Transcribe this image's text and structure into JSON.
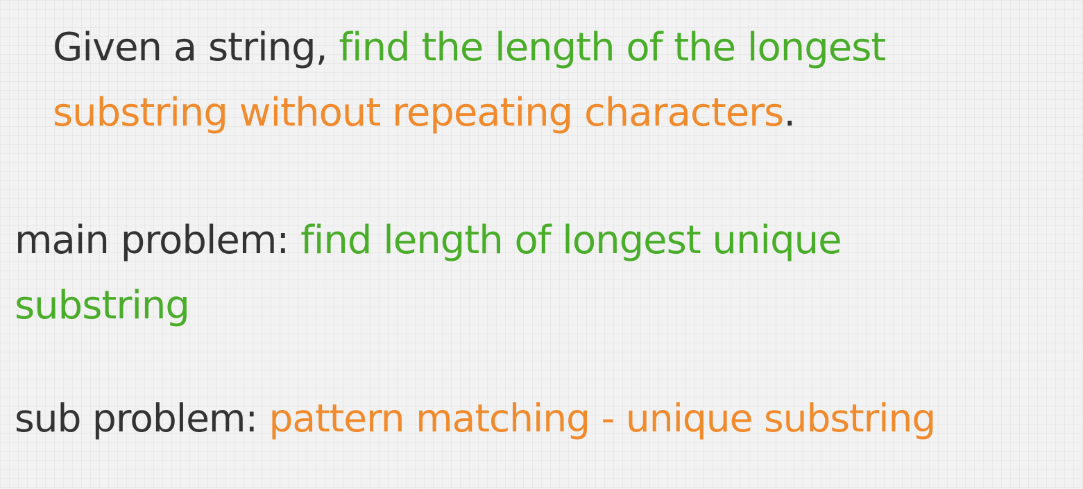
{
  "colors": {
    "text": "#333333",
    "green": "#4aad2a",
    "orange": "#f08a2c"
  },
  "statement": {
    "prefix": "Given a string, ",
    "highlight_green": "find the length of the longest",
    "space": " ",
    "highlight_orange": "substring without repeating characters",
    "suffix": "."
  },
  "main_problem": {
    "label": "main problem: ",
    "value": "find length of longest unique substring"
  },
  "sub_problem": {
    "label": "sub problem: ",
    "value": "pattern matching - unique substring"
  }
}
